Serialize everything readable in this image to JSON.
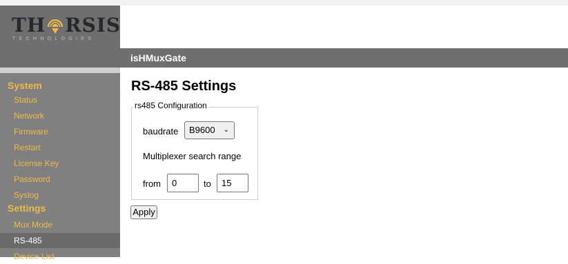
{
  "branding": {
    "logo_word": "THORSIS",
    "logo_sub": "TECHNOLOGIES"
  },
  "header": {
    "app_title": "isHMuxGate"
  },
  "sidebar": {
    "sections": [
      {
        "heading": "System",
        "items": [
          "Status",
          "Network",
          "Firmware",
          "Restart",
          "License Key",
          "Password",
          "Syslog"
        ]
      },
      {
        "heading": "Settings",
        "items": [
          "Mux Mode",
          "RS-485",
          "Device List"
        ]
      }
    ],
    "active_item": "RS-485"
  },
  "main": {
    "page_title": "RS-485 Settings",
    "fieldset_legend": "rs485 Configuration",
    "baudrate_label": "baudrate",
    "baudrate_value": "B9600",
    "range_label": "Multiplexer search range",
    "from_label": "from",
    "from_value": "0",
    "to_label": "to",
    "to_value": "15",
    "apply_label": "Apply"
  },
  "colors": {
    "sidebar_bg": "#808080",
    "header_bg": "#6f6f6f",
    "nav_accent": "#f0b94a",
    "active_bg": "#6a6a6a"
  }
}
